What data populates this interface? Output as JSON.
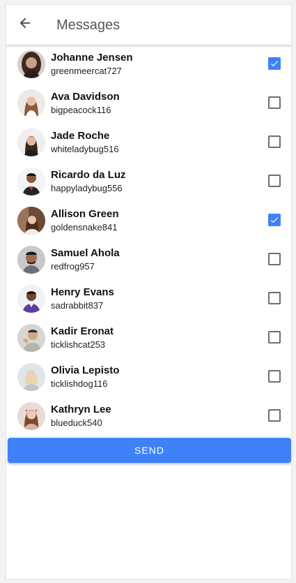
{
  "header": {
    "title": "Messages",
    "back_icon": "arrow-left-icon"
  },
  "colors": {
    "accent": "#3f82f7",
    "checkbox_border": "#6e6e6e"
  },
  "contacts": [
    {
      "name": "Johanne Jensen",
      "username": "greenmeercat727",
      "checked": true
    },
    {
      "name": "Ava Davidson",
      "username": "bigpeacock116",
      "checked": false
    },
    {
      "name": "Jade Roche",
      "username": "whiteladybug516",
      "checked": false
    },
    {
      "name": "Ricardo da Luz",
      "username": "happyladybug556",
      "checked": false
    },
    {
      "name": "Allison Green",
      "username": "goldensnake841",
      "checked": true
    },
    {
      "name": "Samuel Ahola",
      "username": "redfrog957",
      "checked": false
    },
    {
      "name": "Henry Evans",
      "username": "sadrabbit837",
      "checked": false
    },
    {
      "name": "Kadir Eronat",
      "username": "ticklishcat253",
      "checked": false
    },
    {
      "name": "Olivia Lepisto",
      "username": "ticklishdog116",
      "checked": false
    },
    {
      "name": "Kathryn Lee",
      "username": "blueduck540",
      "checked": false
    }
  ],
  "send_button": {
    "label": "SEND"
  }
}
